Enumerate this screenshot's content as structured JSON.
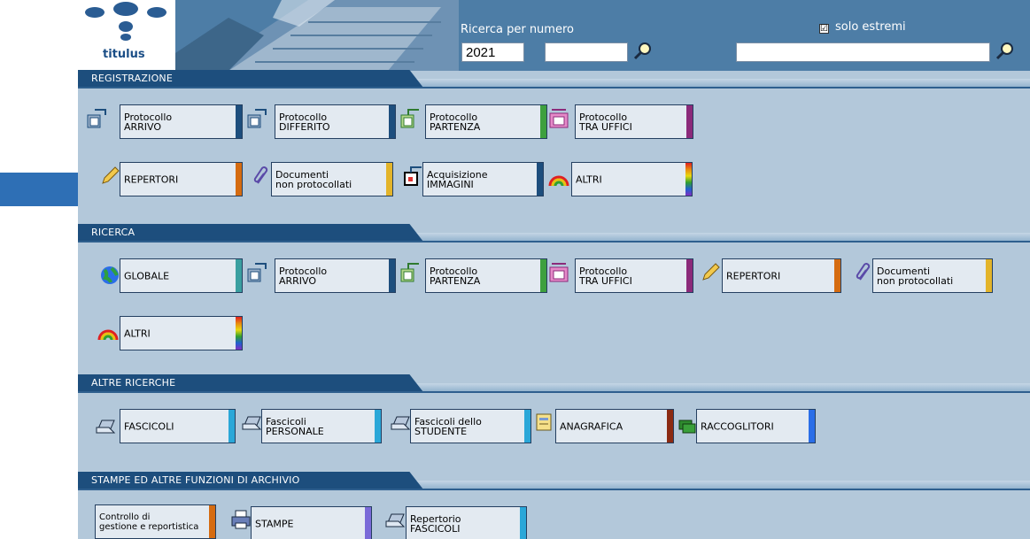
{
  "header": {
    "logo_text": "titulus",
    "search_label": "Ricerca per numero",
    "year_value": "2021",
    "number_value": "",
    "solo_estremi_label": "solo estremi",
    "solo_estremi_checked": "☑",
    "fulltext_value": ""
  },
  "sections": {
    "registrazione": "REGISTRAZIONE",
    "ricerca": "RICERCA",
    "altre_ricerche": "ALTRE RICERCHE",
    "stampe": "STAMPE ED ALTRE FUNZIONI DI ARCHIVIO"
  },
  "registrazione": {
    "protocollo_arrivo": "Protocollo\nARRIVO",
    "protocollo_differito": "Protocollo\nDIFFERITO",
    "protocollo_partenza": "Protocollo\nPARTENZA",
    "protocollo_tra_uffici": "Protocollo\nTRA UFFICI",
    "repertori": "REPERTORI",
    "documenti_non_protocollati": "Documenti\nnon protocollati",
    "acquisizione_immagini": "Acquisizione\nIMMAGINI",
    "altri": "ALTRI"
  },
  "ricerca": {
    "globale": "GLOBALE",
    "protocollo_arrivo": "Protocollo\nARRIVO",
    "protocollo_partenza": "Protocollo\nPARTENZA",
    "protocollo_tra_uffici": "Protocollo\nTRA UFFICI",
    "repertori": "REPERTORI",
    "documenti_non_protocollati": "Documenti\nnon protocollati",
    "altri": "ALTRI"
  },
  "altre_ricerche": {
    "fascicoli": "FASCICOLI",
    "fascicoli_personale": "Fascicoli\nPERSONALE",
    "fascicoli_studente": "Fascicoli dello\nSTUDENTE",
    "anagrafica": "ANAGRAFICA",
    "raccoglitori": "RACCOGLITORI"
  },
  "stampe": {
    "controllo_gestione": "Controllo di\ngestione e reportistica",
    "stampe": "STAMPE",
    "repertorio_fascicoli": "Repertorio\nFASCICOLI"
  },
  "colors": {
    "header_bg": "#4d7da6",
    "section_tab": "#1d4e7d",
    "panel_bg": "#b3c8da",
    "callout_arrow": "#2e6fb5",
    "accent_arrivo": "#1d4e7d",
    "accent_partenza": "#3ea03e",
    "accent_tra_uffici": "#8b2a7a",
    "accent_repertori": "#d56b10",
    "accent_documenti": "#e3b42a",
    "accent_globale": "#3a9fa0",
    "accent_fascicoli": "#2aa7d8",
    "accent_anagrafica": "#8b2a12",
    "accent_raccoglitori": "#2a6ee8",
    "accent_stampe": "#7a6ad8"
  },
  "icons": [
    "arrow-callout-icon",
    "magnifier-icon",
    "protocollo-arrivo-icon",
    "protocollo-differito-icon",
    "protocollo-partenza-icon",
    "protocollo-tra-uffici-icon",
    "pencil-icon",
    "paperclip-icon",
    "scanner-icon",
    "rainbow-icon",
    "globe-icon",
    "folder-icon",
    "address-card-icon",
    "binders-icon",
    "printer-icon"
  ]
}
